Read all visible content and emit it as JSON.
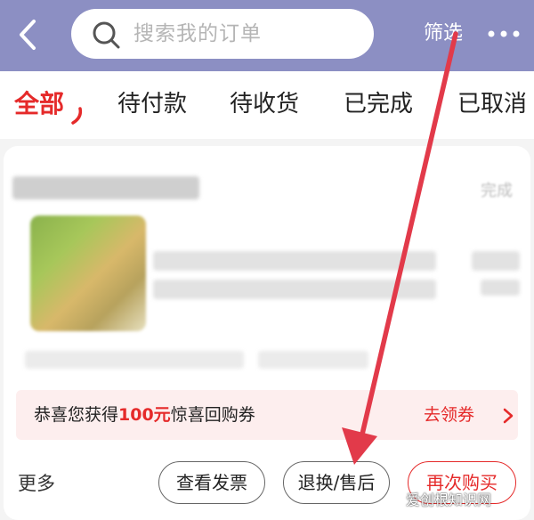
{
  "header": {
    "search_placeholder": "搜索我的订单",
    "filter_label": "筛选"
  },
  "tabs": [
    {
      "label": "全部",
      "active": true
    },
    {
      "label": "待付款",
      "active": false
    },
    {
      "label": "待收货",
      "active": false
    },
    {
      "label": "已完成",
      "active": false
    },
    {
      "label": "已取消",
      "active": false
    }
  ],
  "order": {
    "status": "完成"
  },
  "coupon": {
    "prefix": "恭喜您获得",
    "amount": "100元",
    "suffix": "惊喜回购券",
    "link": "去领券"
  },
  "actions": {
    "more_label": "更多",
    "invoice_label": "查看发票",
    "return_label": "退换/售后",
    "rebuy_label": "再次购买"
  },
  "watermark": "爱创根知识网",
  "colors": {
    "header_bg": "#8c8fc3",
    "accent": "#e52a2a",
    "arrow": "#e23a4a"
  }
}
